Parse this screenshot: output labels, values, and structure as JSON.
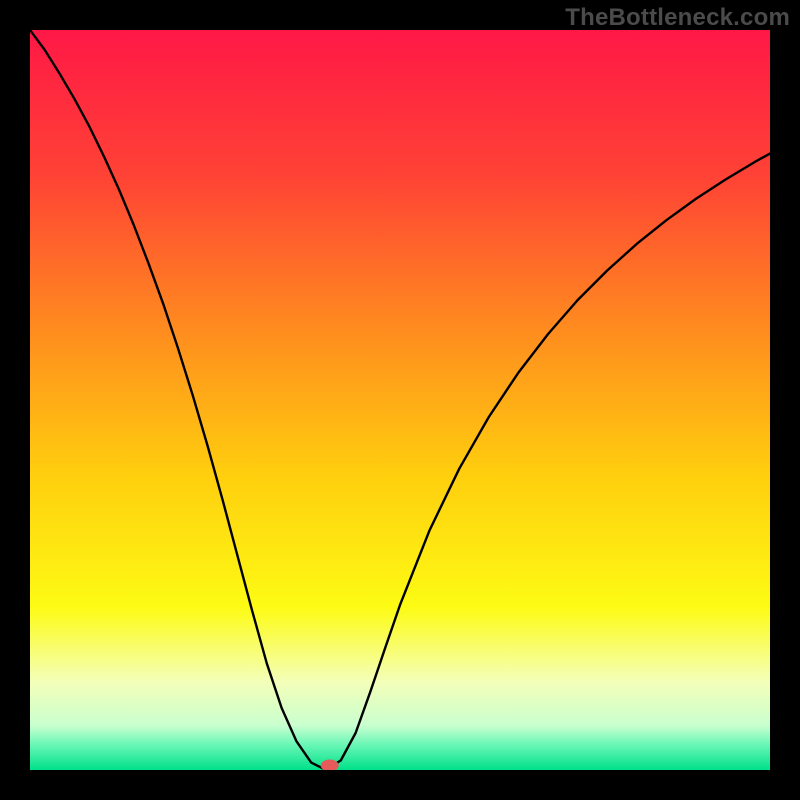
{
  "watermark": "TheBottleneck.com",
  "chart_data": {
    "type": "line",
    "title": "",
    "xlabel": "",
    "ylabel": "",
    "xlim": [
      0,
      100
    ],
    "ylim": [
      0,
      100
    ],
    "background_gradient_stops": [
      {
        "pos": 0.0,
        "color": "#ff1846"
      },
      {
        "pos": 0.2,
        "color": "#ff4335"
      },
      {
        "pos": 0.4,
        "color": "#ff8a1f"
      },
      {
        "pos": 0.6,
        "color": "#ffce0e"
      },
      {
        "pos": 0.78,
        "color": "#fdfb14"
      },
      {
        "pos": 0.88,
        "color": "#f4ffb8"
      },
      {
        "pos": 0.94,
        "color": "#c9ffcf"
      },
      {
        "pos": 0.965,
        "color": "#6cf7b7"
      },
      {
        "pos": 1.0,
        "color": "#00e08a"
      }
    ],
    "series": [
      {
        "name": "bottleneck-curve",
        "note": "x in [0,100], y in [0,100]; y is percent bottleneck; 0 at minimum near x≈40",
        "x": [
          0,
          2,
          4,
          6,
          8,
          10,
          12,
          14,
          16,
          18,
          20,
          22,
          24,
          26,
          28,
          30,
          32,
          34,
          36,
          38,
          40,
          42,
          44,
          46,
          48,
          50,
          54,
          58,
          62,
          66,
          70,
          74,
          78,
          82,
          86,
          90,
          94,
          98,
          100
        ],
        "y": [
          100,
          97.3,
          94.1,
          90.7,
          87.0,
          82.9,
          78.5,
          73.7,
          68.5,
          63.0,
          57.0,
          50.6,
          43.8,
          36.6,
          29.1,
          21.6,
          14.4,
          8.4,
          3.9,
          1.0,
          0.0,
          1.3,
          5.0,
          10.6,
          16.5,
          22.3,
          32.4,
          40.7,
          47.7,
          53.7,
          58.9,
          63.5,
          67.5,
          71.1,
          74.3,
          77.2,
          79.8,
          82.2,
          83.3
        ]
      }
    ],
    "marker": {
      "name": "optimal-point",
      "x": 40.5,
      "y": 0.6,
      "color": "#e65a5a",
      "rx": 9,
      "ry": 6
    }
  }
}
